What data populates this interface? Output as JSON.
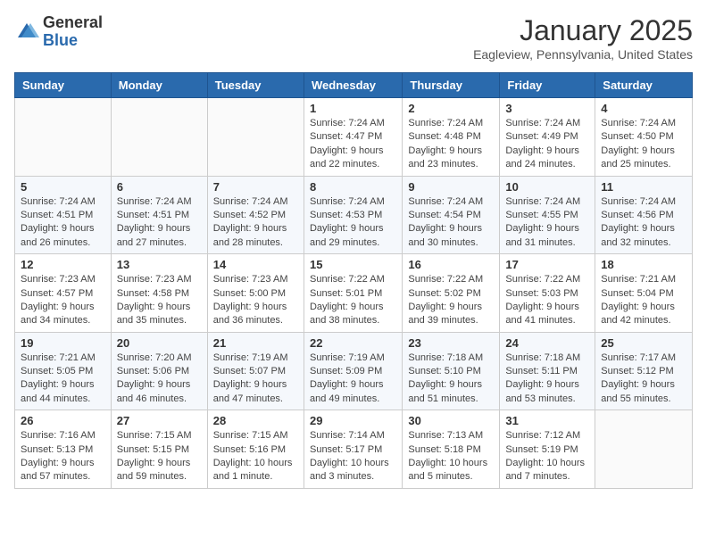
{
  "header": {
    "logo_general": "General",
    "logo_blue": "Blue",
    "month_title": "January 2025",
    "location": "Eagleview, Pennsylvania, United States"
  },
  "weekdays": [
    "Sunday",
    "Monday",
    "Tuesday",
    "Wednesday",
    "Thursday",
    "Friday",
    "Saturday"
  ],
  "weeks": [
    [
      {
        "day": "",
        "info": ""
      },
      {
        "day": "",
        "info": ""
      },
      {
        "day": "",
        "info": ""
      },
      {
        "day": "1",
        "info": "Sunrise: 7:24 AM\nSunset: 4:47 PM\nDaylight: 9 hours and 22 minutes."
      },
      {
        "day": "2",
        "info": "Sunrise: 7:24 AM\nSunset: 4:48 PM\nDaylight: 9 hours and 23 minutes."
      },
      {
        "day": "3",
        "info": "Sunrise: 7:24 AM\nSunset: 4:49 PM\nDaylight: 9 hours and 24 minutes."
      },
      {
        "day": "4",
        "info": "Sunrise: 7:24 AM\nSunset: 4:50 PM\nDaylight: 9 hours and 25 minutes."
      }
    ],
    [
      {
        "day": "5",
        "info": "Sunrise: 7:24 AM\nSunset: 4:51 PM\nDaylight: 9 hours and 26 minutes."
      },
      {
        "day": "6",
        "info": "Sunrise: 7:24 AM\nSunset: 4:51 PM\nDaylight: 9 hours and 27 minutes."
      },
      {
        "day": "7",
        "info": "Sunrise: 7:24 AM\nSunset: 4:52 PM\nDaylight: 9 hours and 28 minutes."
      },
      {
        "day": "8",
        "info": "Sunrise: 7:24 AM\nSunset: 4:53 PM\nDaylight: 9 hours and 29 minutes."
      },
      {
        "day": "9",
        "info": "Sunrise: 7:24 AM\nSunset: 4:54 PM\nDaylight: 9 hours and 30 minutes."
      },
      {
        "day": "10",
        "info": "Sunrise: 7:24 AM\nSunset: 4:55 PM\nDaylight: 9 hours and 31 minutes."
      },
      {
        "day": "11",
        "info": "Sunrise: 7:24 AM\nSunset: 4:56 PM\nDaylight: 9 hours and 32 minutes."
      }
    ],
    [
      {
        "day": "12",
        "info": "Sunrise: 7:23 AM\nSunset: 4:57 PM\nDaylight: 9 hours and 34 minutes."
      },
      {
        "day": "13",
        "info": "Sunrise: 7:23 AM\nSunset: 4:58 PM\nDaylight: 9 hours and 35 minutes."
      },
      {
        "day": "14",
        "info": "Sunrise: 7:23 AM\nSunset: 5:00 PM\nDaylight: 9 hours and 36 minutes."
      },
      {
        "day": "15",
        "info": "Sunrise: 7:22 AM\nSunset: 5:01 PM\nDaylight: 9 hours and 38 minutes."
      },
      {
        "day": "16",
        "info": "Sunrise: 7:22 AM\nSunset: 5:02 PM\nDaylight: 9 hours and 39 minutes."
      },
      {
        "day": "17",
        "info": "Sunrise: 7:22 AM\nSunset: 5:03 PM\nDaylight: 9 hours and 41 minutes."
      },
      {
        "day": "18",
        "info": "Sunrise: 7:21 AM\nSunset: 5:04 PM\nDaylight: 9 hours and 42 minutes."
      }
    ],
    [
      {
        "day": "19",
        "info": "Sunrise: 7:21 AM\nSunset: 5:05 PM\nDaylight: 9 hours and 44 minutes."
      },
      {
        "day": "20",
        "info": "Sunrise: 7:20 AM\nSunset: 5:06 PM\nDaylight: 9 hours and 46 minutes."
      },
      {
        "day": "21",
        "info": "Sunrise: 7:19 AM\nSunset: 5:07 PM\nDaylight: 9 hours and 47 minutes."
      },
      {
        "day": "22",
        "info": "Sunrise: 7:19 AM\nSunset: 5:09 PM\nDaylight: 9 hours and 49 minutes."
      },
      {
        "day": "23",
        "info": "Sunrise: 7:18 AM\nSunset: 5:10 PM\nDaylight: 9 hours and 51 minutes."
      },
      {
        "day": "24",
        "info": "Sunrise: 7:18 AM\nSunset: 5:11 PM\nDaylight: 9 hours and 53 minutes."
      },
      {
        "day": "25",
        "info": "Sunrise: 7:17 AM\nSunset: 5:12 PM\nDaylight: 9 hours and 55 minutes."
      }
    ],
    [
      {
        "day": "26",
        "info": "Sunrise: 7:16 AM\nSunset: 5:13 PM\nDaylight: 9 hours and 57 minutes."
      },
      {
        "day": "27",
        "info": "Sunrise: 7:15 AM\nSunset: 5:15 PM\nDaylight: 9 hours and 59 minutes."
      },
      {
        "day": "28",
        "info": "Sunrise: 7:15 AM\nSunset: 5:16 PM\nDaylight: 10 hours and 1 minute."
      },
      {
        "day": "29",
        "info": "Sunrise: 7:14 AM\nSunset: 5:17 PM\nDaylight: 10 hours and 3 minutes."
      },
      {
        "day": "30",
        "info": "Sunrise: 7:13 AM\nSunset: 5:18 PM\nDaylight: 10 hours and 5 minutes."
      },
      {
        "day": "31",
        "info": "Sunrise: 7:12 AM\nSunset: 5:19 PM\nDaylight: 10 hours and 7 minutes."
      },
      {
        "day": "",
        "info": ""
      }
    ]
  ]
}
